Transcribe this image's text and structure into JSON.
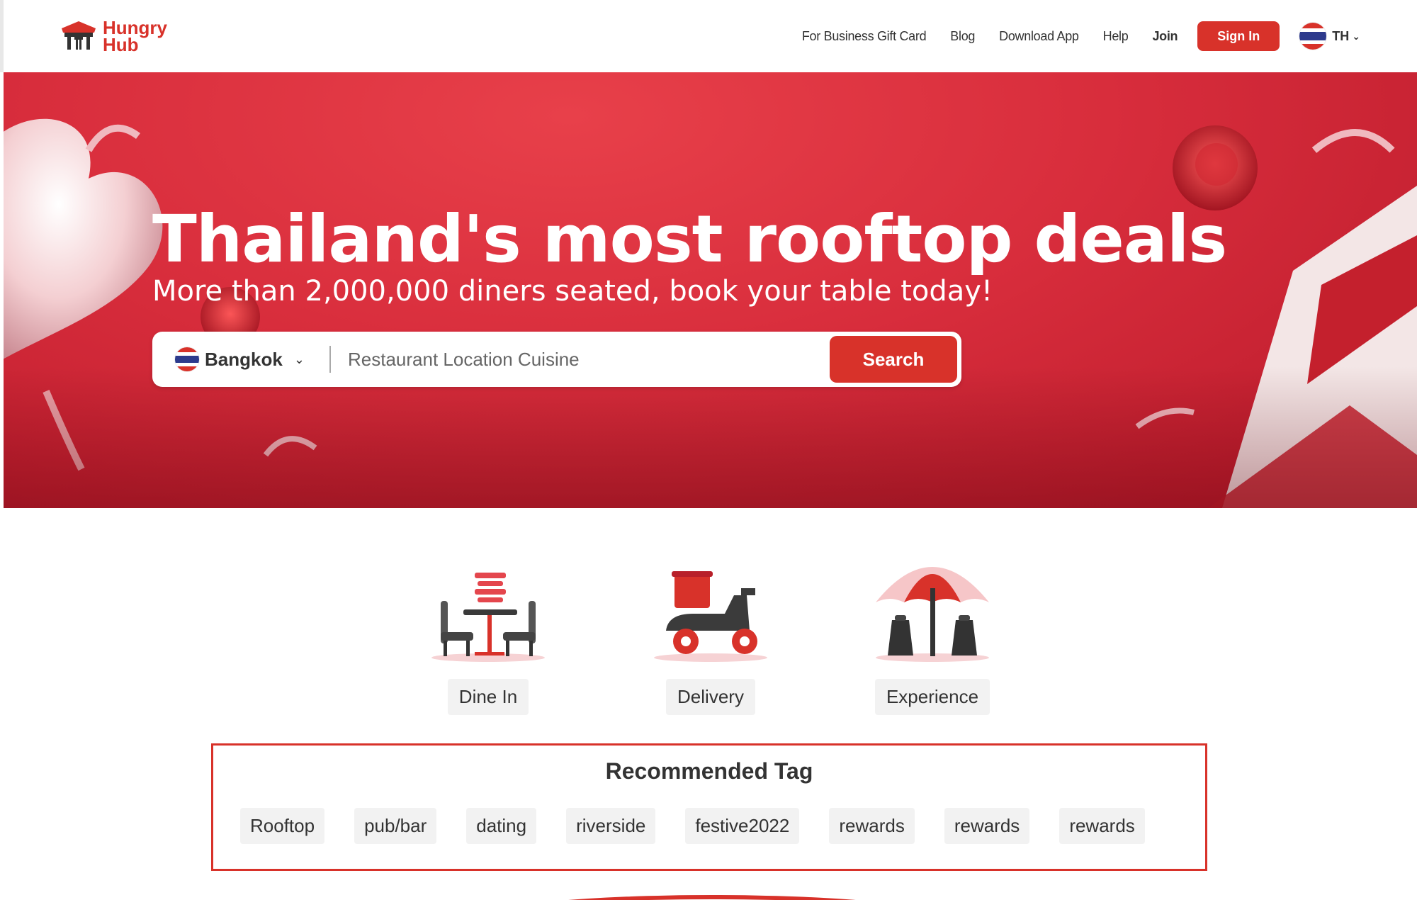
{
  "header": {
    "logo_text_1": "Hungry",
    "logo_text_2": "Hub",
    "nav": {
      "business_gift_card": "For Business Gift Card",
      "blog": "Blog",
      "download_app": "Download App",
      "help": "Help",
      "join": "Join",
      "sign_in": "Sign In"
    },
    "language": {
      "code": "TH",
      "chevron": "⌄"
    }
  },
  "hero": {
    "title": "Thailand's most rooftop deals",
    "subtitle": "More than 2,000,000 diners seated, book your table today!",
    "search": {
      "city": "Bangkok",
      "placeholder": "Restaurant Location Cuisine",
      "button": "Search"
    }
  },
  "categories": [
    {
      "label": "Dine In",
      "icon": "dine-in-icon"
    },
    {
      "label": "Delivery",
      "icon": "delivery-scooter-icon"
    },
    {
      "label": "Experience",
      "icon": "umbrella-icon"
    }
  ],
  "recommended": {
    "title": "Recommended Tag",
    "tags": [
      "Rooftop",
      "pub/bar",
      "dating",
      "riverside",
      "festive2022",
      "rewards",
      "rewards",
      "rewards"
    ]
  },
  "colors": {
    "brand_red": "#d8322a",
    "hero_red": "#d82d3c",
    "tag_bg": "#f2f2f2"
  }
}
